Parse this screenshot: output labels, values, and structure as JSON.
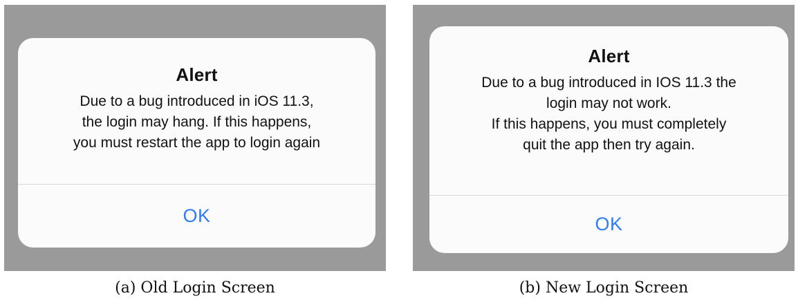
{
  "panels": [
    {
      "alert": {
        "title": "Alert",
        "message": "Due to a bug introduced in iOS 11.3,\nthe login may hang. If this happens,\nyou must restart the app to login again",
        "ok_label": "OK"
      },
      "caption": "(a) Old Login Screen"
    },
    {
      "alert": {
        "title": "Alert",
        "message": "Due to a bug introduced in IOS 11.3 the\nlogin may not work.\nIf this happens, you must completely\nquit the app then try again.",
        "ok_label": "OK"
      },
      "caption": "(b) New Login Screen"
    }
  ],
  "colors": {
    "backdrop": "#9a9a9a",
    "alert_background": "#fbfbfb",
    "button_text": "#2f7cf6",
    "divider": "#d8d8de"
  }
}
